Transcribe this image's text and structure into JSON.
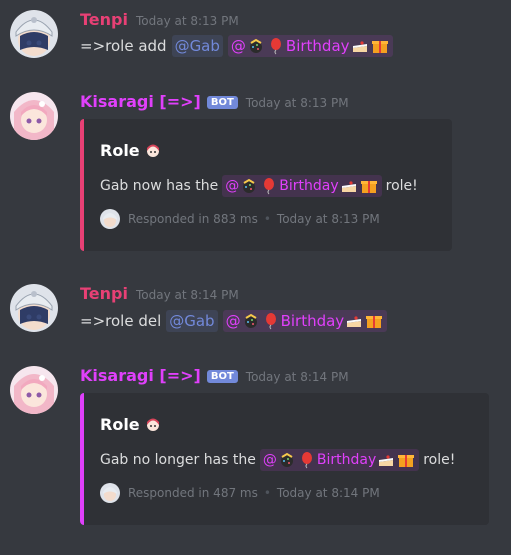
{
  "colors": {
    "background": "#36393f",
    "embed_bg": "#2f3136",
    "user_name": "#e84075",
    "mention_user": "#7289da",
    "mention_role": "#e040fb",
    "bot_tag": "#7289da",
    "timestamp": "#72767d"
  },
  "messages": [
    {
      "author": "Tenpi",
      "timestamp": "Today at 8:13 PM",
      "command": "=>role add",
      "user_mention": "@Gab",
      "role_mention_prefix": "@",
      "role_mention_name": "Birthday"
    },
    {
      "author": "Kisaragi [=>]",
      "bot_tag": "BOT",
      "timestamp": "Today at 8:13 PM",
      "embed": {
        "accent": "#e84075",
        "title": "Role",
        "desc_before": "Gab now has the",
        "role_prefix": "@",
        "role_name": "Birthday",
        "desc_after": "role!",
        "footer_text": "Responded in 883 ms",
        "footer_time": "Today at 8:13 PM"
      }
    },
    {
      "author": "Tenpi",
      "timestamp": "Today at 8:14 PM",
      "command": "=>role del",
      "user_mention": "@Gab",
      "role_mention_prefix": "@",
      "role_mention_name": "Birthday"
    },
    {
      "author": "Kisaragi [=>]",
      "bot_tag": "BOT",
      "timestamp": "Today at 8:14 PM",
      "embed": {
        "accent": "#e040fb",
        "title": "Role",
        "desc_before": "Gab no longer has the",
        "role_prefix": "@",
        "role_name": "Birthday",
        "desc_after": "role!",
        "footer_text": "Responded in 487 ms",
        "footer_time": "Today at 8:14 PM"
      }
    }
  ],
  "icons": {
    "role_emojis_before": [
      "confetti-ball-icon",
      "balloon-icon"
    ],
    "role_emojis_after": [
      "cake-icon",
      "gift-icon"
    ],
    "embed_title_icon": "anime-girl-icon"
  }
}
